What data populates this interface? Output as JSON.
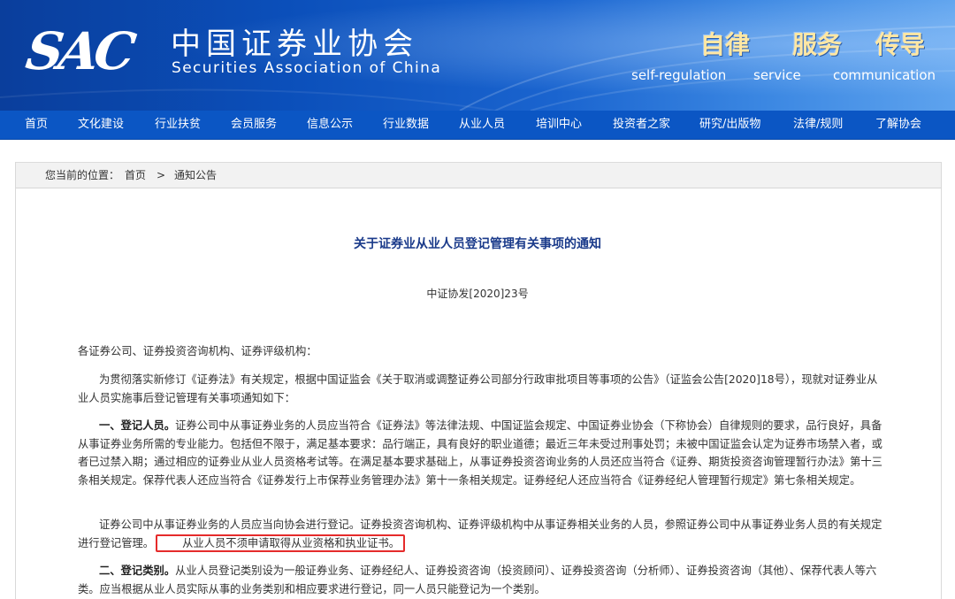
{
  "header": {
    "logo_mark": "SAC",
    "org_name_cn": "中国证券业协会",
    "org_name_en": "Securities Association of China",
    "slogans": [
      {
        "cn": "自律",
        "en": "self-regulation"
      },
      {
        "cn": "服务",
        "en": "service"
      },
      {
        "cn": "传导",
        "en": "communication"
      }
    ]
  },
  "nav": {
    "items": [
      "首页",
      "文化建设",
      "行业扶贫",
      "会员服务",
      "信息公示",
      "行业数据",
      "从业人员",
      "培训中心",
      "投资者之家",
      "研究/出版物",
      "法律/规则",
      "了解协会"
    ]
  },
  "breadcrumb": {
    "prefix": "您当前的位置：",
    "home": "首页",
    "separator": ">",
    "current": "通知公告"
  },
  "article": {
    "title": "关于证券业从业人员登记管理有关事项的通知",
    "doc_number": "中证协发[2020]23号",
    "salutation": "各证券公司、证券投资咨询机构、证券评级机构：",
    "intro": "为贯彻落实新修订《证券法》有关规定，根据中国证监会《关于取消或调整证券公司部分行政审批项目等事项的公告》（证监会公告[2020]18号），现就对证券业从业人员实施事后登记管理有关事项通知如下：",
    "section1_heading": "一、登记人员。",
    "section1_body": "证券公司中从事证券业务的人员应当符合《证券法》等法律法规、中国证监会规定、中国证券业协会（下称协会）自律规则的要求，品行良好，具备从事证券业务所需的专业能力。包括但不限于，满足基本要求：品行端正，具有良好的职业道德；最近三年未受过刑事处罚；未被中国证监会认定为证券市场禁入者，或者已过禁入期；通过相应的证券业从业人员资格考试等。在满足基本要求基础上，从事证券投资咨询业务的人员还应当符合《证券、期货投资咨询管理暂行办法》第十三条相关规定。保荐代表人还应当符合《证券发行上市保荐业务管理办法》第十一条相关规定。证券经纪人还应当符合《证券经纪人管理暂行规定》第七条相关规定。",
    "para2_body": "证券公司中从事证券业务的人员应当向协会进行登记。证券投资咨询机构、证券评级机构中从事证券相关业务的人员，参照证券公司中从事证券业务人员的有关规定进行登记管理。",
    "para2_highlight": "从业人员不须申请取得从业资格和执业证书。",
    "section2_heading": "二、登记类别。",
    "section2_body": "从业人员登记类别设为一般证券业务、证券经纪人、证券投资咨询（投资顾问）、证券投资咨询（分析师）、证券投资咨询（其他）、保荐代表人等六类。应当根据从业人员实际从事的业务类别和相应要求进行登记，同一人员只能登记为一个类别。"
  },
  "colors": {
    "banner": "#0b4fba",
    "nav": "#0b56c4",
    "title": "#1a3a8a",
    "highlight_border": "#e52b2b"
  }
}
